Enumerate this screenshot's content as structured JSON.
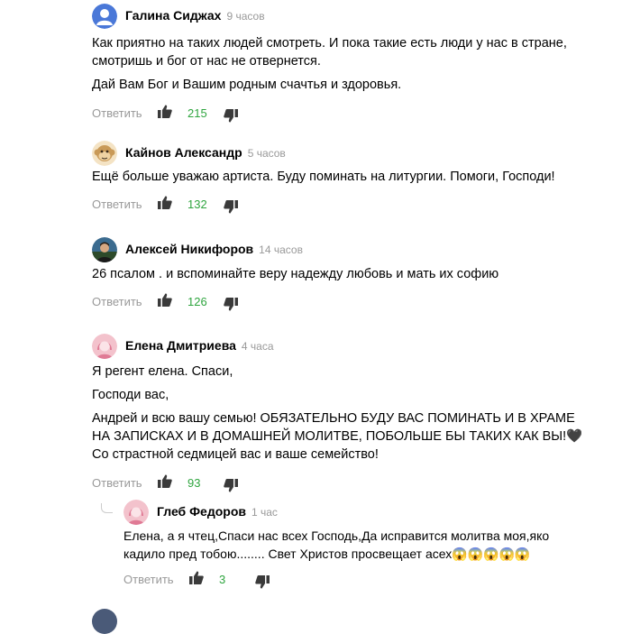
{
  "comments": [
    {
      "author": "Галина Сиджах",
      "time": "9 часов",
      "paragraphs": [
        "Как приятно на таких людей смотреть. И пока такие есть люди у нас в стране,\nсмотришь и бог от нас не отвернется.",
        "Дай Вам Бог и Вашим родным счачтья и здоровья."
      ],
      "reply_label": "Ответить",
      "likes": "215",
      "avatar": "default-user-icon",
      "avatar_color": "#4a78d8"
    },
    {
      "author": "Кайнов Александр",
      "time": "5 часов",
      "paragraphs": [
        "Ещё больше уважаю артиста. Буду поминать на литургии. Помоги, Господи!"
      ],
      "reply_label": "Ответить",
      "likes": "132",
      "avatar": "monkey-icon",
      "avatar_color": "#c99a58"
    },
    {
      "author": "Алексей Никифоров",
      "time": "14 часов",
      "paragraphs": [
        "26 псалом . и вспоминайте веру надежду любовь и мать их софию"
      ],
      "reply_label": "Ответить",
      "likes": "126",
      "avatar": "photo-avatar",
      "avatar_color": "#3b6b8f"
    },
    {
      "author": "Елена Дмитриева",
      "time": "4 часа",
      "paragraphs": [
        "Я регент елена. Спаси,",
        "Господи вас,",
        "Андрей и всю вашу семью! ОБЯЗАТЕЛЬНО БУДУ ВАС ПОМИНАТЬ И В ХРАМЕ\nНА ЗАПИСКАХ И В ДОМАШНЕЙ МОЛИТВЕ, ПОБОЛЬШЕ БЫ ТАКИХ КАК ВЫ!🖤\nСо страстной седмицей вас и ваше семейство!"
      ],
      "reply_label": "Ответить",
      "likes": "93",
      "avatar": "woman-icon",
      "avatar_color": "#f3c2cc"
    },
    {
      "author": "Глеб Федоров",
      "time": "1 час",
      "paragraphs": [
        "Елена, а я чтец,Спаси нас всех Господь,Да исправится молитва моя,яко\nкадило пред тобою........ Свет Христов просвещает асех😱😱😱😱😱"
      ],
      "reply_label": "Ответить",
      "likes": "3",
      "avatar": "woman-icon",
      "avatar_color": "#f3c2cc"
    }
  ],
  "colors": {
    "likes": "#2fa53f",
    "meta": "#999999",
    "icon": "#3a3a3a"
  }
}
